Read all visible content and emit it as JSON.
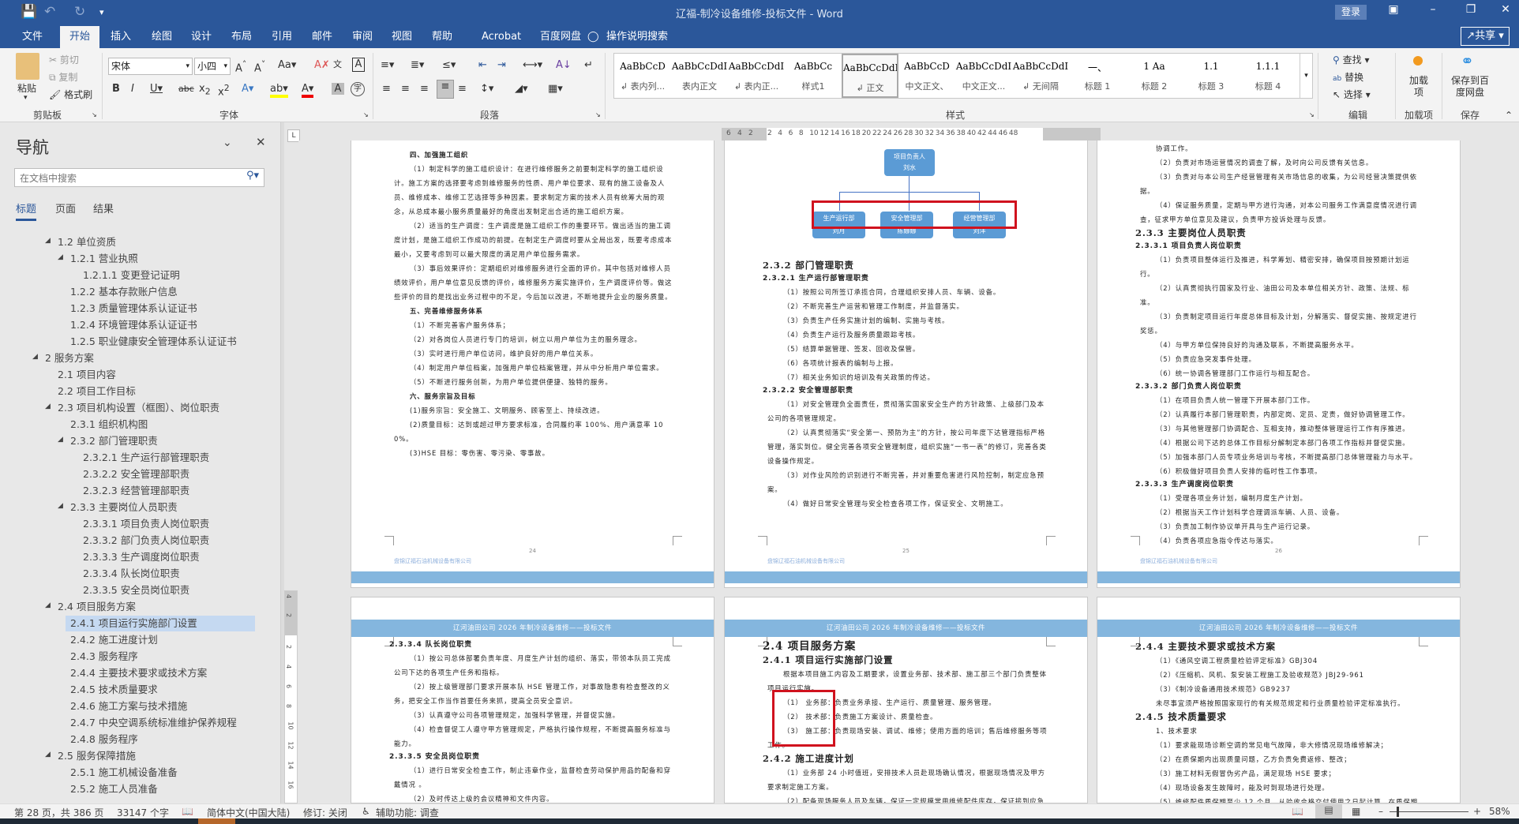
{
  "titlebar": {
    "title": "辽福-制冷设备维修-投标文件  -  Word",
    "login": "登录",
    "save_icon": "save-icon",
    "undo_icon": "undo-icon",
    "redo_icon": "redo-icon"
  },
  "tabs": [
    "文件",
    "开始",
    "插入",
    "绘图",
    "设计",
    "布局",
    "引用",
    "邮件",
    "审阅",
    "视图",
    "帮助",
    "Acrobat",
    "百度网盘"
  ],
  "tell_me": "操作说明搜索",
  "share": "共享",
  "ribbon": {
    "clipboard": {
      "label": "剪贴板",
      "paste": "粘贴",
      "cut": "剪切",
      "copy": "复制",
      "format_painter": "格式刷"
    },
    "font": {
      "label": "字体",
      "name": "宋体",
      "size": "小四"
    },
    "paragraph": {
      "label": "段落"
    },
    "styles": {
      "label": "样式",
      "items": [
        {
          "preview": "AaBbCcD",
          "name": "↲ 表内列..."
        },
        {
          "preview": "AaBbCcDdI",
          "name": "表内正文"
        },
        {
          "preview": "AaBbCcDdI",
          "name": "↲ 表内正..."
        },
        {
          "preview": "AaBbCc",
          "name": "样式1"
        },
        {
          "preview": "AaBbCcDdI",
          "name": "↲ 正文"
        },
        {
          "preview": "AaBbCcD",
          "name": "中文正文、"
        },
        {
          "preview": "AaBbCcDdI",
          "name": "中文正文..."
        },
        {
          "preview": "AaBbCcDdI",
          "name": "↲ 无间隔"
        },
        {
          "preview": "一、",
          "name": "标题 1"
        },
        {
          "preview": "1  Aa",
          "name": "标题 2"
        },
        {
          "preview": "1.1",
          "name": "标题 3"
        },
        {
          "preview": "1.1.1",
          "name": "标题 4"
        }
      ],
      "selected": 4
    },
    "editing": {
      "label": "编辑",
      "find": "查找",
      "replace": "替换",
      "select": "选择"
    },
    "addins": {
      "label": "加载项",
      "button": "加载项"
    },
    "save": {
      "label": "保存",
      "button": "保存到百度网盘"
    }
  },
  "nav": {
    "title": "导航",
    "search_placeholder": "在文档中搜索",
    "tabs": [
      "标题",
      "页面",
      "结果"
    ],
    "active_tab": 0,
    "items": [
      {
        "t": "1.2 单位资质",
        "lvl": 2,
        "exp": true
      },
      {
        "t": "1.2.1 营业执照",
        "lvl": 3,
        "exp": true
      },
      {
        "t": "1.2.1.1 变更登记证明",
        "lvl": 4
      },
      {
        "t": "1.2.2 基本存款账户信息",
        "lvl": 3
      },
      {
        "t": "1.2.3 质量管理体系认证证书",
        "lvl": 3
      },
      {
        "t": "1.2.4 环境管理体系认证证书",
        "lvl": 3
      },
      {
        "t": "1.2.5 职业健康安全管理体系认证证书",
        "lvl": 3
      },
      {
        "t": "2 服务方案",
        "lvl": 1,
        "exp": true
      },
      {
        "t": "2.1 项目内容",
        "lvl": 2
      },
      {
        "t": "2.2 项目工作目标",
        "lvl": 2
      },
      {
        "t": "2.3 项目机构设置（框图）、岗位职责",
        "lvl": 2,
        "exp": true
      },
      {
        "t": "2.3.1 组织机构图",
        "lvl": 3
      },
      {
        "t": "2.3.2 部门管理职责",
        "lvl": 3,
        "exp": true
      },
      {
        "t": "2.3.2.1 生产运行部管理职责",
        "lvl": 4
      },
      {
        "t": "2.3.2.2 安全管理部职责",
        "lvl": 4
      },
      {
        "t": "2.3.2.3 经营管理部职责",
        "lvl": 4
      },
      {
        "t": "2.3.3 主要岗位人员职责",
        "lvl": 3,
        "exp": true
      },
      {
        "t": "2.3.3.1 项目负责人岗位职责",
        "lvl": 4
      },
      {
        "t": "2.3.3.2 部门负责人岗位职责",
        "lvl": 4
      },
      {
        "t": "2.3.3.3 生产调度岗位职责",
        "lvl": 4
      },
      {
        "t": "2.3.3.4 队长岗位职责",
        "lvl": 4
      },
      {
        "t": "2.3.3.5 安全员岗位职责",
        "lvl": 4
      },
      {
        "t": "2.4 项目服务方案",
        "lvl": 2,
        "exp": true
      },
      {
        "t": "2.4.1 项目运行实施部门设置",
        "lvl": 3,
        "selected": true
      },
      {
        "t": "2.4.2 施工进度计划",
        "lvl": 3
      },
      {
        "t": "2.4.3 服务程序",
        "lvl": 3
      },
      {
        "t": "2.4.4 主要技术要求或技术方案",
        "lvl": 3
      },
      {
        "t": "2.4.5 技术质量要求",
        "lvl": 3
      },
      {
        "t": "2.4.6 施工方案与技术措施",
        "lvl": 3
      },
      {
        "t": "2.4.7 中央空调系统标准维护保养规程",
        "lvl": 3
      },
      {
        "t": "2.4.8 服务程序",
        "lvl": 3
      },
      {
        "t": "2.5 服务保障措施",
        "lvl": 2,
        "exp": true
      },
      {
        "t": "2.5.1 施工机械设备准备",
        "lvl": 3
      },
      {
        "t": "2.5.2 施工人员准备",
        "lvl": 3
      }
    ]
  },
  "ruler": {
    "h_ticks": [
      "6",
      "4",
      "2",
      "2",
      "4",
      "6",
      "8",
      "10",
      "12",
      "14",
      "16",
      "18",
      "20",
      "22",
      "24",
      "26",
      "28",
      "30",
      "32",
      "34",
      "36",
      "38",
      "40",
      "42",
      "44",
      "46",
      "48"
    ],
    "v_ticks": [
      "4",
      "2",
      "2",
      "4",
      "6",
      "8",
      "10",
      "12",
      "14",
      "16"
    ]
  },
  "document": {
    "header_text": "辽河油田公司 2026 年制冷设备维修——投标文件",
    "footer_company": "盘锦辽福石油机械设备有限公司",
    "footer_company_link": "辽福石油"
  },
  "pages": [
    {
      "number": "24",
      "paras": [
        {
          "k": "hz",
          "t": "四、加强施工组织"
        },
        {
          "k": "p",
          "t": "（1）制定科学的施工组织设计：在进行维修服务之前要制定科学的施工组织设计。施工方案的选择要考虑到维修服务的性质、用户单位要求、现有的施工设备及人员、维修成本、维修工艺选择等多种因素。要求制定方案的技术人员有统筹大局的观念，从总成本最小服务质量最好的角度出发制定出合适的施工组织方案。"
        },
        {
          "k": "p",
          "t": "（2）适当的生产调度：生产调度是施工组织工作的重要环节。做出适当的施工调度计划，是施工组织工作成功的前提。在制定生产调度时要从全局出发，既要考虑成本最小，又要考虑到可以最大限度的满足用户单位服务需求。"
        },
        {
          "k": "p",
          "t": "（3）事后效果评价：定期组织对维修服务进行全面的评价。其中包括对维修人员绩效评价，用户单位意见反馈的评价，维修服务方案实施评价，生产调度评价等。做这些评价的目的是找出业务过程中的不足，今后加以改进，不断地提升企业的服务质量。"
        },
        {
          "k": "hz",
          "t": "五、完善维修服务体系"
        },
        {
          "k": "p",
          "t": "（1）不断完善客户服务体系；"
        },
        {
          "k": "p",
          "t": "（2）对各岗位人员进行专门的培训，树立以用户单位为主的服务理念。"
        },
        {
          "k": "p",
          "t": "（3）实时进行用户单位访问，维护良好的用户单位关系。"
        },
        {
          "k": "p",
          "t": "（4）制定用户单位档案，加强用户单位档案管理，并从中分析用户单位需求。"
        },
        {
          "k": "p",
          "t": "（5）不断进行服务创新，为用户单位提供便捷、独特的服务。"
        },
        {
          "k": "hz",
          "t": "六、服务宗旨及目标"
        },
        {
          "k": "p",
          "t": "(1)服务宗旨：安全施工、文明服务、顾客至上、持续改进。"
        },
        {
          "k": "p",
          "t": "(2)质量目标：达到或超过甲方要求标准，合同履约率 100%、用户满意率 100%。"
        },
        {
          "k": "p",
          "t": "(3)HSE 目标：零伤害、零污染、零事故。"
        }
      ]
    },
    {
      "number": "25",
      "org": {
        "top_title": "项目负责人",
        "top_name": "刘水",
        "depts": [
          {
            "title": "生产运行部",
            "name": "刘月"
          },
          {
            "title": "安全管理部",
            "name": "陈娜娜"
          },
          {
            "title": "经营管理部",
            "name": "刘洋"
          }
        ]
      },
      "paras": [
        {
          "k": "h2",
          "t": "2.3.2 部门管理职责"
        },
        {
          "k": "h3",
          "t": "2.3.2.1 生产运行部管理职责"
        },
        {
          "k": "p",
          "t": "（1）按照公司所签订承揽合同，合理组织安排人员、车辆、设备。"
        },
        {
          "k": "p",
          "t": "（2）不断完善生产运营和管理工作制度，并监督落实。"
        },
        {
          "k": "p",
          "t": "（3）负责生产任务实施计划的编制、实施与考核。"
        },
        {
          "k": "p",
          "t": "（4）负责生产运行及服务质量跟踪考核。"
        },
        {
          "k": "p",
          "t": "（5）结算单据管理、签发、回收及保管。"
        },
        {
          "k": "p",
          "t": "（6）各项统计报表的编制与上报。"
        },
        {
          "k": "p",
          "t": "（7）相关业务知识的培训及有关政策的传达。"
        },
        {
          "k": "h3",
          "t": "2.3.2.2 安全管理部职责"
        },
        {
          "k": "p",
          "t": "（1）对安全管理负全面责任，贯彻落实国家安全生产的方针政策、上级部门及本公司的各项管理规定。"
        },
        {
          "k": "p",
          "t": "（2）认真贯彻落实“安全第一、预防为主”的方针，按公司年度下达管理指标严格管理，落实到位。健全完善各项安全管理制度，组织实施“一书一表”的修订，完善各类设备操作规定。"
        },
        {
          "k": "p",
          "t": "（3）对作业风险的识别进行不断完善，并对重要危害进行风险控制，制定应急预案。"
        },
        {
          "k": "p",
          "t": "（4）做好日常安全管理与安全检查各项工作，保证安全、文明施工。"
        }
      ]
    },
    {
      "number": "26",
      "paras": [
        {
          "k": "ni",
          "t": "协调工作。"
        },
        {
          "k": "p",
          "t": "（2）负责对市场运营情况的调查了解，及时向公司反馈有关信息。"
        },
        {
          "k": "p",
          "t": "（3）负责对与本公司生产经营管理有关市场信息的收集，为公司经营决策提供依据。"
        },
        {
          "k": "p",
          "t": "（4）保证服务质量，定期与甲方进行沟通，对本公司服务工作满意度情况进行调查，征求甲方单位意见及建议，负责甲方投诉处理与反馈。"
        },
        {
          "k": "h2",
          "t": "2.3.3 主要岗位人员职责"
        },
        {
          "k": "h3",
          "t": "2.3.3.1 项目负责人岗位职责"
        },
        {
          "k": "p",
          "t": "（1）负责项目整体运行及推进，科学筹划、精密安排，确保项目按预期计划运行。"
        },
        {
          "k": "p",
          "t": "（2）认真贯彻执行国家及行业、油田公司及本单位相关方针、政策、法规、标准。"
        },
        {
          "k": "p",
          "t": "（3）负责制定项目运行年度总体目标及计划，分解落实、督促实施、按规定进行奖惩。"
        },
        {
          "k": "p",
          "t": "（4）与甲方单位保持良好的沟通及联系，不断提高服务水平。"
        },
        {
          "k": "p",
          "t": "（5）负责应急突发事件处理。"
        },
        {
          "k": "p",
          "t": "（6）统一协调各管理部门工作运行与相互配合。"
        },
        {
          "k": "h3",
          "t": "2.3.3.2 部门负责人岗位职责"
        },
        {
          "k": "p",
          "t": "（1）在项目负责人统一管理下开展本部门工作。"
        },
        {
          "k": "p",
          "t": "（2）认真履行本部门管理职责，内部定岗、定员、定责，做好协调管理工作。"
        },
        {
          "k": "p",
          "t": "（3）与其他管理部门协调配合、互相支持，推动整体管理运行工作有序推进。"
        },
        {
          "k": "p",
          "t": "（4）根据公司下达的总体工作目标分解制定本部门各项工作指标并督促实施。"
        },
        {
          "k": "p",
          "t": "（5）加强本部门人员专项业务培训与考核，不断提高部门总体管理能力与水平。"
        },
        {
          "k": "p",
          "t": "（6）积极做好项目负责人安排的临时性工作事项。"
        },
        {
          "k": "h3",
          "t": "2.3.3.3 生产调度岗位职责"
        },
        {
          "k": "p",
          "t": "（1）受理各项业务计划，编制月度生产计划。"
        },
        {
          "k": "p",
          "t": "（2）根据当天工作计划科学合理调派车辆、人员、设备。"
        },
        {
          "k": "p",
          "t": "（3）负责加工制作协议单开具与生产运行记录。"
        },
        {
          "k": "p",
          "t": "（4）负责各项应急指令传达与落实。"
        }
      ]
    },
    {
      "paras": [
        {
          "k": "h3",
          "t": "2.3.3.4 队长岗位职责"
        },
        {
          "k": "p",
          "t": "（1）按公司总体部署负责年度、月度生产计划的组织、落实，带领本队员工完成公司下达的各项生产任务和指标。"
        },
        {
          "k": "p",
          "t": "（2）按上级管理部门要求开展本队 HSE 管理工作，对事故隐患有检查整改的义务，把安全工作当作首要任务来抓，提高全员安全意识。"
        },
        {
          "k": "p",
          "t": "（3）认真遵守公司各项管理规定，加强科学管理，并督促实施。"
        },
        {
          "k": "p",
          "t": "（4）检查督促工人遵守甲方管理规定，严格执行操作规程，不断提高服务标准与能力。"
        },
        {
          "k": "h3",
          "t": "2.3.3.5 安全员岗位职责"
        },
        {
          "k": "p",
          "t": "（1）进行日常安全检查工作，制止违章作业，监督检查劳动保护用品的配备和穿戴情况 。"
        },
        {
          "k": "p",
          "t": "（2）及时传达上级的会议精神和文件内容。"
        }
      ]
    },
    {
      "paras": [
        {
          "k": "h1",
          "t": "2.4 项目服务方案"
        },
        {
          "k": "h2",
          "t": "2.4.1 项目运行实施部门设置"
        },
        {
          "k": "p",
          "t": "根据本项目施工内容及工期要求，设置业务部、技术部、施工部三个部门负责整体项目运行实施。"
        },
        {
          "k": "p",
          "t": "（1）  业务部：负责业务承接、生产运行、质量管理、服务管理。"
        },
        {
          "k": "p",
          "t": "（2）  技术部：负责施工方案设计、质量检查。"
        },
        {
          "k": "p",
          "t": "（3）  施工部：负责现场安装、调试、维修；使用方面的培训；售后维修服务等项工作。"
        },
        {
          "k": "h2",
          "t": "2.4.2 施工进度计划"
        },
        {
          "k": "p",
          "t": "（1）业务部 24 小时值班，安排技术人员赴现场确认情况，根据现场情况及甲方要求制定施工方案。"
        },
        {
          "k": "p",
          "t": "（2）配备现场服务人员及车辆，保证一定规模常用维修配件库存，保证接到应急维"
        }
      ]
    },
    {
      "paras": [
        {
          "k": "h2",
          "t": "2.4.4 主要技术要求或技术方案"
        },
        {
          "k": "p",
          "t": "（1）《通风空调工程质量检验评定标准》GBJ304"
        },
        {
          "k": "p",
          "t": "（2）《压缩机、风机、泵安装工程施工及验收规范》JBJ29-961"
        },
        {
          "k": "p",
          "t": "（3）《制冷设备通用技术规范》GB9237"
        },
        {
          "k": "ni",
          "t": "未尽事宜须严格按照国家现行的有关规范规定和行业质量检验评定标准执行。"
        },
        {
          "k": "h2",
          "t": "2.4.5 技术质量要求"
        },
        {
          "k": "ni",
          "t": "1、技术要求"
        },
        {
          "k": "p",
          "t": "（1）要求能现场诊断空调的常见电气故障，非大修情况现场维修解决；"
        },
        {
          "k": "p",
          "t": "（2）在质保期内出现质量问题，乙方负责免费返修、整改；"
        },
        {
          "k": "p",
          "t": "（3）施工材料无假冒伪劣产品，满足现场 HSE 要求；"
        },
        {
          "k": "p",
          "t": "（4）现场设备发生故障时，能及时到现场进行处理。"
        },
        {
          "k": "p",
          "t": "（5）维修配件质保期至少 12 个月，从验收合格交付使用之日起计算。在质保期内"
        }
      ]
    }
  ],
  "statusbar": {
    "page": "第 28 页，共 386 页",
    "words": "33147 个字",
    "language": "简体中文(中国大陆)",
    "track": "修订: 关闭",
    "accessibility": "辅助功能: 调查",
    "zoom": "58%",
    "zoom_level": 58
  },
  "colors": {
    "brand": "#2b579a",
    "highlight": "#d0121e",
    "header_band": "#84b6de",
    "org_box": "#5b9bd5",
    "nav_selected": "#c5d9f1"
  }
}
